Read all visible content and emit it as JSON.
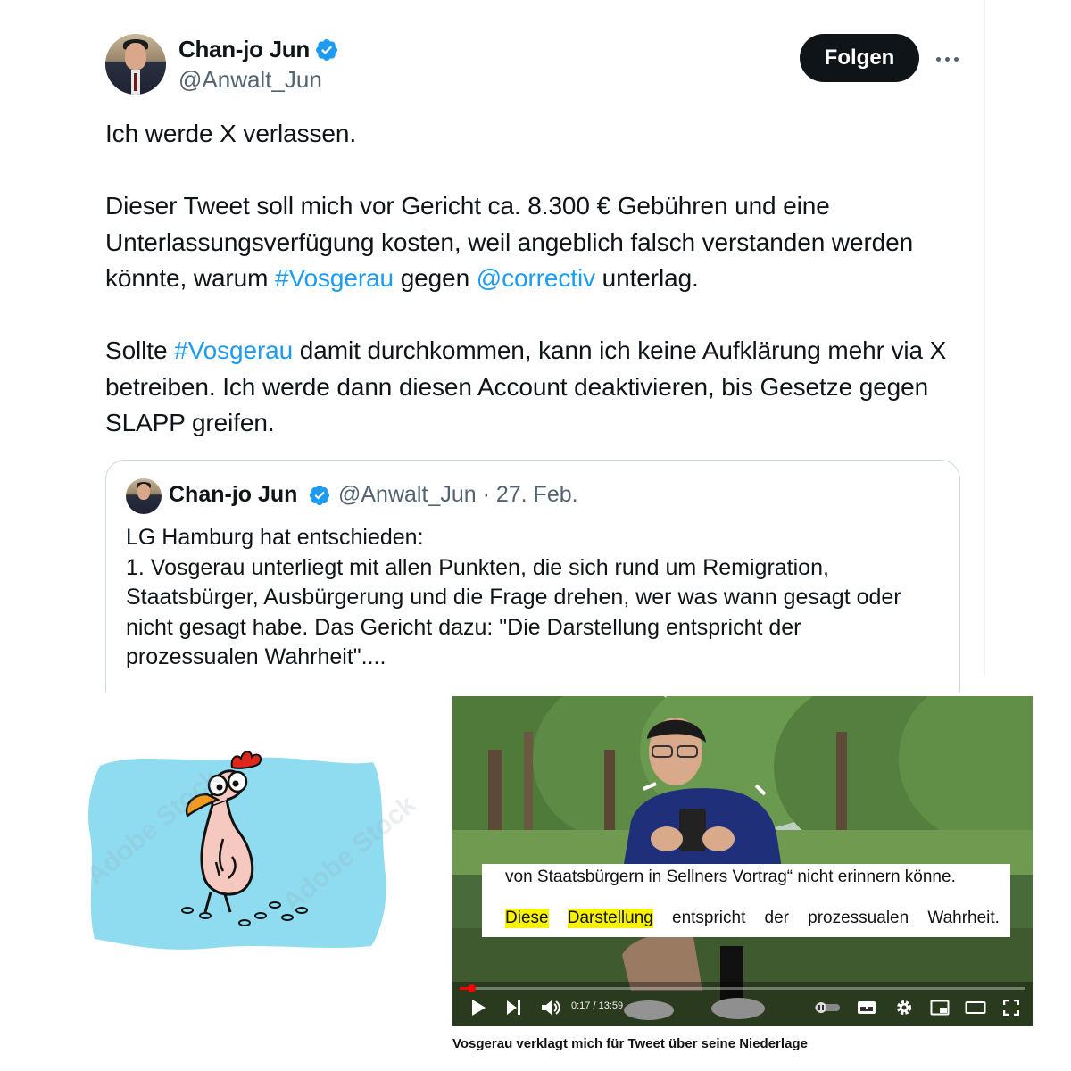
{
  "tweet": {
    "author_name": "Chan-jo Jun",
    "handle": "@Anwalt_Jun",
    "follow_label": "Folgen",
    "paragraphs": [
      [
        {
          "t": "Ich werde X verlassen."
        }
      ],
      [
        {
          "t": "Dieser Tweet soll mich vor Gericht ca. 8.300 € Gebühren und eine Unterlassungsverfügung kosten, weil angeblich falsch verstanden werden könnte, warum "
        },
        {
          "t": "#Vosgerau",
          "link": true
        },
        {
          "t": " gegen "
        },
        {
          "t": "@correctiv",
          "link": true
        },
        {
          "t": " unterlag."
        }
      ],
      [
        {
          "t": "Sollte "
        },
        {
          "t": "#Vosgerau",
          "link": true
        },
        {
          "t": " damit durchkommen, kann ich keine Aufklärung mehr via X betreiben. Ich werde dann diesen Account deaktivieren, bis Gesetze gegen SLAPP greifen."
        }
      ]
    ]
  },
  "quote": {
    "author_name": "Chan-jo Jun",
    "meta": "@Anwalt_Jun · 27. Feb.",
    "lines": [
      "LG Hamburg hat entschieden:",
      "1. Vosgerau unterliegt mit allen Punkten, die sich rund um Remigration,",
      "Staatsbürger, Ausbürgerung und die Frage drehen, wer was wann gesagt oder",
      "nicht gesagt habe. Das Gericht dazu: \"Die Darstellung entspricht der",
      "prozessualen Wahrheit\"...."
    ]
  },
  "chicken": {
    "watermark": "Adobe Stock"
  },
  "video": {
    "subtitle_line1": "von Staatsbürgern in Sellners Vortrag“ nicht erinnern könne.",
    "subtitle_line2": [
      {
        "t": "Diese",
        "highlight": true
      },
      {
        "t": "Darstellung",
        "highlight": true
      },
      {
        "t": "entspricht",
        "highlight": false
      },
      {
        "t": "der",
        "highlight": false
      },
      {
        "t": "prozessualen",
        "highlight": false
      },
      {
        "t": "Wahrheit.",
        "highlight": false
      }
    ],
    "time_display": "0:17 / 13:59",
    "progress_fraction": 0.0203,
    "caption": "Vosgerau verklagt mich für Tweet über seine Niederlage"
  },
  "colors": {
    "link": "#1d9bf0",
    "muted": "#536471",
    "verified": "#1d9bf0",
    "progress": "#ff0000",
    "subtitle_highlight": "#f6f200"
  }
}
